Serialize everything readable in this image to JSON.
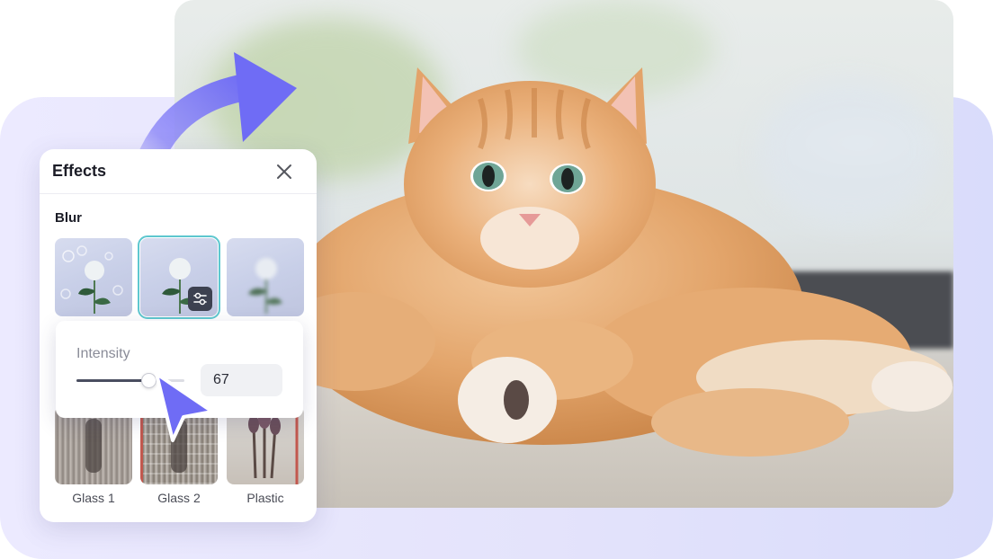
{
  "panel": {
    "title": "Effects",
    "close_icon": "close-icon",
    "section": "Blur",
    "blur_options": [
      {
        "icon": "blur-bokeh-thumbnail"
      },
      {
        "icon": "blur-soft-thumbnail",
        "selected": true,
        "adjust_icon": "sliders-icon"
      },
      {
        "icon": "blur-strong-thumbnail"
      }
    ],
    "intensity": {
      "label": "Intensity",
      "value": "67",
      "fraction": 0.67
    },
    "glass_options": [
      {
        "label": "Glass 1"
      },
      {
        "label": "Glass 2"
      },
      {
        "label": "Plastic"
      }
    ]
  },
  "photo": {
    "subject": "cat-photo"
  },
  "colors": {
    "accent": "#6f6cf5",
    "selected_outline": "#5ec7cf",
    "background_panel": "#e4e3fb"
  }
}
